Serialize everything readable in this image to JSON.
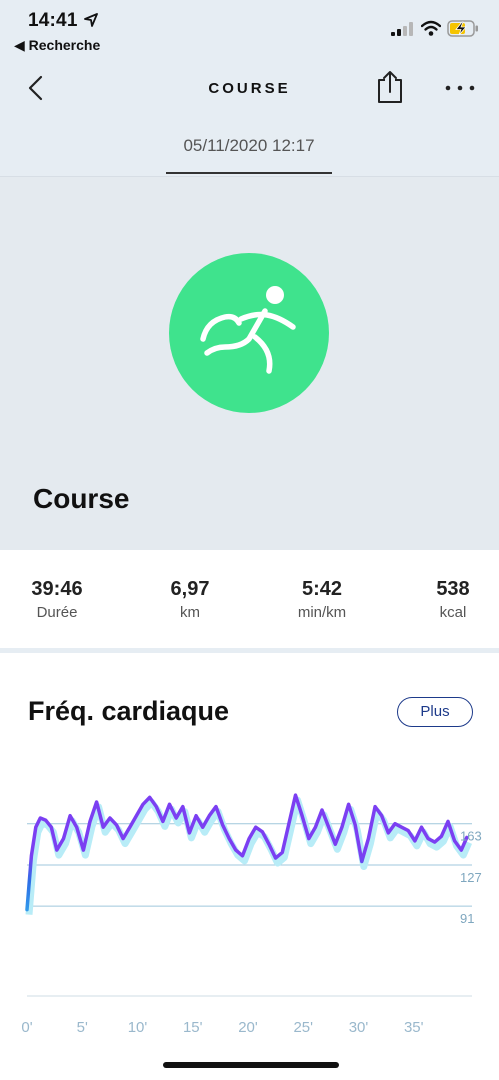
{
  "status_bar": {
    "time": "14:41",
    "back_app": "◀ Recherche",
    "battery_color": "#f5c400"
  },
  "nav": {
    "title": "COURSE",
    "back_icon": "chevron-left-icon",
    "share_icon": "share-icon",
    "more_icon": "more-horizontal-icon"
  },
  "date_tab": "05/11/2020 12:17",
  "activity": {
    "name": "Course",
    "icon": "runner-icon",
    "icon_bg": "#3fe38d"
  },
  "stats": [
    {
      "value": "39:46",
      "label": "Durée"
    },
    {
      "value": "6,97",
      "label": "km"
    },
    {
      "value": "5:42",
      "label": "min/km"
    },
    {
      "value": "538",
      "label": "kcal"
    }
  ],
  "heart_rate": {
    "title": "Fréq. cardiaque",
    "more_button": "Plus"
  },
  "chart_data": {
    "type": "line",
    "x_unit": "minutes",
    "xticks": [
      "0'",
      "5'",
      "10'",
      "15'",
      "20'",
      "25'",
      "30'",
      "35'"
    ],
    "xlim": [
      0,
      40
    ],
    "y_reference_lines": [
      163,
      127,
      91
    ],
    "y_labels": [
      "163",
      "127",
      "91"
    ],
    "ylim": [
      30,
      175
    ],
    "colors": {
      "low": "#36c6f0",
      "mid": "#2d6ee6",
      "high": "#7b3ff2",
      "shadow": "#b8ecf7"
    },
    "series": [
      {
        "x": [
          0,
          0.4,
          0.8,
          1.2,
          1.7,
          2.2,
          2.7,
          3.3,
          3.9,
          4.5,
          5.1,
          5.7,
          6.3,
          6.9,
          7.5,
          8.1,
          8.7,
          9.3,
          9.9,
          10.5,
          11.1,
          11.7,
          12.3,
          12.9,
          13.5,
          14.1,
          14.7,
          15.3,
          15.9,
          16.5,
          17.1,
          17.7,
          18.3,
          18.9,
          19.5,
          20.1,
          20.7,
          21.3,
          21.9,
          22.5,
          23.1,
          23.7,
          24.3,
          24.9,
          25.5,
          26.1,
          26.7,
          27.3,
          27.9,
          28.5,
          29.1,
          29.7,
          30.3,
          30.9,
          31.5,
          32.1,
          32.7,
          33.3,
          33.9,
          34.5,
          35.1,
          35.7,
          36.3,
          36.9,
          37.5,
          38.1,
          38.7,
          39.3,
          39.8
        ],
        "y": [
          88,
          135,
          160,
          168,
          166,
          160,
          140,
          150,
          170,
          160,
          140,
          165,
          182,
          160,
          168,
          162,
          150,
          160,
          170,
          180,
          186,
          178,
          165,
          180,
          168,
          178,
          155,
          170,
          160,
          170,
          178,
          162,
          150,
          140,
          135,
          150,
          160,
          156,
          145,
          133,
          138,
          163,
          188,
          170,
          150,
          160,
          175,
          160,
          145,
          160,
          180,
          162,
          130,
          150,
          178,
          170,
          155,
          163,
          160,
          157,
          148,
          160,
          150,
          147,
          152,
          165,
          148,
          140,
          151
        ]
      }
    ]
  }
}
